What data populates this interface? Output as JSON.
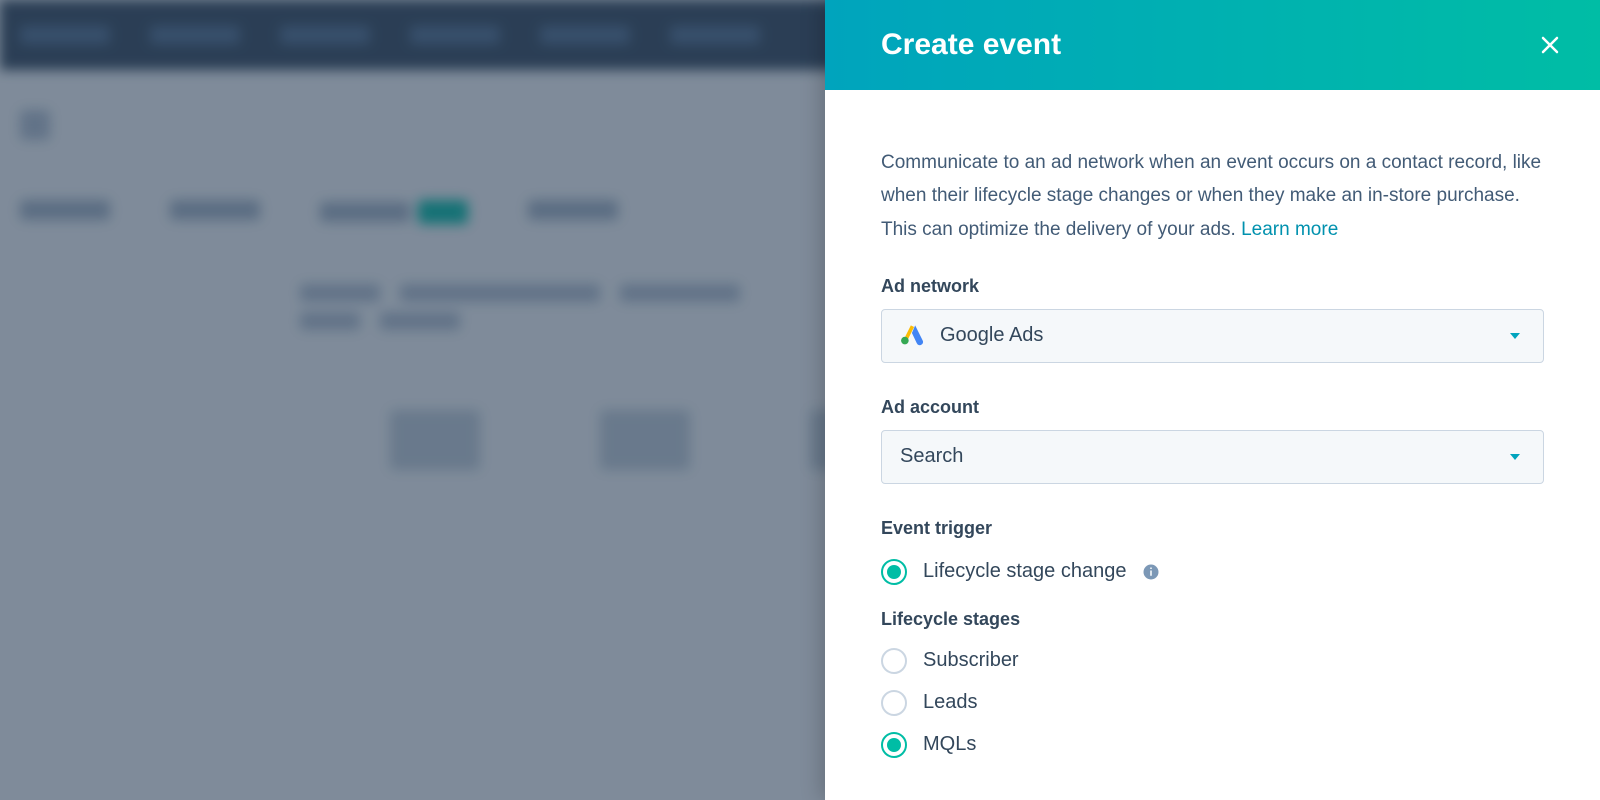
{
  "panel": {
    "title": "Create event",
    "description": "Communicate to an ad network when an event occurs on a contact record, like when their lifecycle stage changes or when they make an in-store purchase. This can optimize the delivery of your ads. ",
    "learn_more": "Learn more",
    "labels": {
      "ad_network": "Ad network",
      "ad_account": "Ad account",
      "event_trigger": "Event trigger",
      "lifecycle_stages": "Lifecycle stages"
    },
    "ad_network_value": "Google Ads",
    "ad_account_value": "Search",
    "event_trigger_option": "Lifecycle stage change",
    "lifecycle_options": [
      {
        "label": "Subscriber",
        "selected": false
      },
      {
        "label": "Leads",
        "selected": false
      },
      {
        "label": "MQLs",
        "selected": true
      }
    ]
  }
}
